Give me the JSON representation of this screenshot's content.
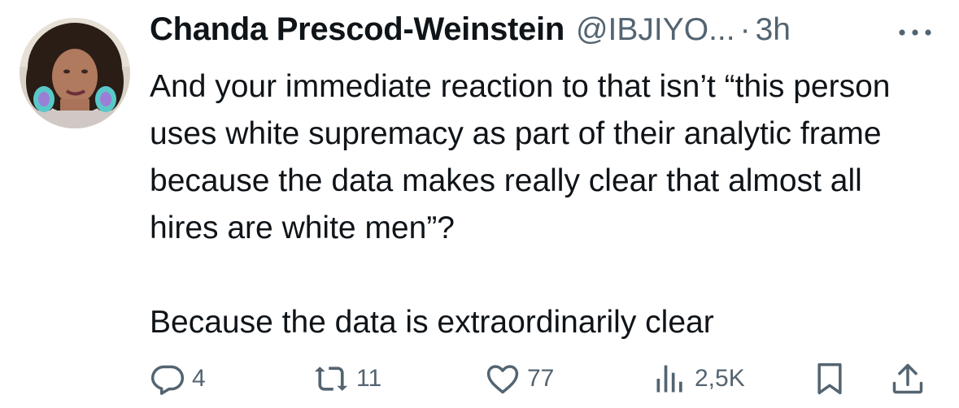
{
  "author": {
    "name": "Chanda Prescod-Weinstein",
    "handle": "@IBJIYO...",
    "separator": "·",
    "time": "3h"
  },
  "tweet": {
    "paragraphs": [
      "And your immediate reaction to that isn’t “this person uses white supremacy as part of their analytic frame because the data makes really clear that almost all hires are white men”?",
      "Because the data is extraordinarily clear"
    ]
  },
  "actions": {
    "replies": "4",
    "retweets": "11",
    "likes": "77",
    "views": "2,5K"
  },
  "icons": {
    "more": "more-horizontal-icon",
    "reply": "reply-icon",
    "retweet": "retweet-icon",
    "like": "heart-icon",
    "views": "views-chart-icon",
    "bookmark": "bookmark-icon",
    "share": "share-icon"
  },
  "colors": {
    "text": "#0f1419",
    "secondary": "#536471",
    "background": "#ffffff"
  }
}
